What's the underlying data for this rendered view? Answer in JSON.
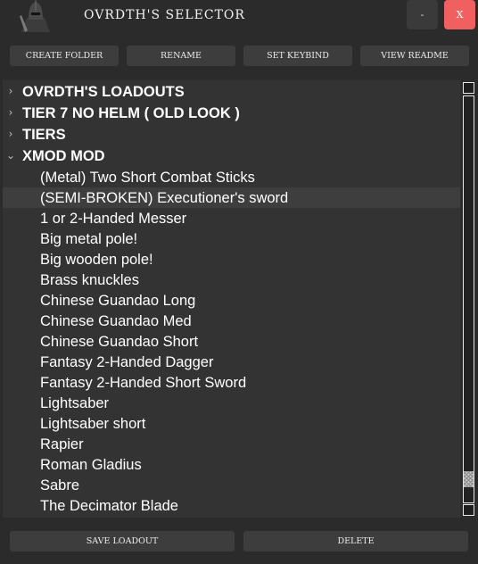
{
  "window": {
    "title": "OVRDTH'S SELECTOR",
    "minimize_label": "-",
    "close_label": "X"
  },
  "toolbar": {
    "create_folder_label": "CREATE FOLDER",
    "rename_label": "RENAME",
    "set_keybind_label": "SET KEYBIND",
    "view_readme_label": "VIEW README"
  },
  "tree": {
    "folders": [
      {
        "label": "OVRDTH'S LOADOUTS",
        "expanded": false
      },
      {
        "label": "TIER 7 NO HELM ( OLD LOOK )",
        "expanded": false
      },
      {
        "label": "TIERS",
        "expanded": false
      },
      {
        "label": "XMOD MOD",
        "expanded": true
      }
    ],
    "items": [
      "(Metal) Two Short Combat Sticks",
      "(SEMI-BROKEN) Executioner's sword",
      "1 or 2-Handed Messer",
      "Big metal pole!",
      "Big wooden pole!",
      "Brass knuckles",
      "Chinese Guandao Long",
      "Chinese Guandao Med",
      "Chinese Guandao Short",
      "Fantasy 2-Handed Dagger",
      "Fantasy 2-Handed Short Sword",
      "Lightsaber",
      "Lightsaber short",
      "Rapier",
      "Roman Gladius",
      "Sabre",
      "The Decimator Blade"
    ],
    "selected_item": "(SEMI-BROKEN) Executioner's sword"
  },
  "scrollbar": {
    "position_fraction": 0.96,
    "visible_fraction": 0.04
  },
  "actions": {
    "save_loadout_label": "SAVE LOADOUT",
    "delete_label": "DELETE"
  },
  "icons": {
    "logo": "knight-helmet-icon",
    "collapsed": "chevron-right-icon",
    "expanded": "chevron-down-icon"
  },
  "colors": {
    "background": "#2b2b2b",
    "panel": "#333333",
    "button": "#3d3d3d",
    "close_button": "#f06060",
    "selection": "#3e3e3e"
  }
}
